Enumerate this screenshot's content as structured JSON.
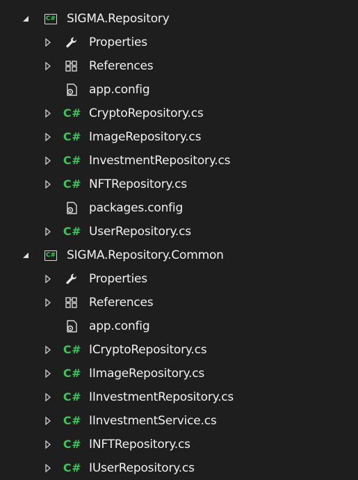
{
  "projects": [
    {
      "name": "SIGMA.Repository",
      "expanded": true,
      "items": [
        {
          "label": "Properties",
          "icon": "wrench-icon",
          "expander": true
        },
        {
          "label": "References",
          "icon": "references-icon",
          "expander": true
        },
        {
          "label": "app.config",
          "icon": "config-file-icon",
          "expander": false
        },
        {
          "label": "CryptoRepository.cs",
          "icon": "csharp-file-icon",
          "expander": true
        },
        {
          "label": "ImageRepository.cs",
          "icon": "csharp-file-icon",
          "expander": true
        },
        {
          "label": "InvestmentRepository.cs",
          "icon": "csharp-file-icon",
          "expander": true
        },
        {
          "label": "NFTRepository.cs",
          "icon": "csharp-file-icon",
          "expander": true
        },
        {
          "label": "packages.config",
          "icon": "config-file-icon",
          "expander": false
        },
        {
          "label": "UserRepository.cs",
          "icon": "csharp-file-icon",
          "expander": true
        }
      ]
    },
    {
      "name": "SIGMA.Repository.Common",
      "expanded": true,
      "items": [
        {
          "label": "Properties",
          "icon": "wrench-icon",
          "expander": true
        },
        {
          "label": "References",
          "icon": "references-icon",
          "expander": true
        },
        {
          "label": "app.config",
          "icon": "config-file-icon",
          "expander": false
        },
        {
          "label": "ICryptoRepository.cs",
          "icon": "csharp-file-icon",
          "expander": true
        },
        {
          "label": "IImageRepository.cs",
          "icon": "csharp-file-icon",
          "expander": true
        },
        {
          "label": "IInvestmentRepository.cs",
          "icon": "csharp-file-icon",
          "expander": true
        },
        {
          "label": "IInvestmentService.cs",
          "icon": "csharp-file-icon",
          "expander": true
        },
        {
          "label": "INFTRepository.cs",
          "icon": "csharp-file-icon",
          "expander": true
        },
        {
          "label": "IUserRepository.cs",
          "icon": "csharp-file-icon",
          "expander": true
        }
      ]
    }
  ],
  "glyphs": {
    "csharp": "C#",
    "project_badge": "C#"
  },
  "colors": {
    "background": "#1e1e1e",
    "text": "#f1f1f1",
    "csharp_green": "#3fc35c",
    "glyph_gray": "#d8d8d8"
  }
}
